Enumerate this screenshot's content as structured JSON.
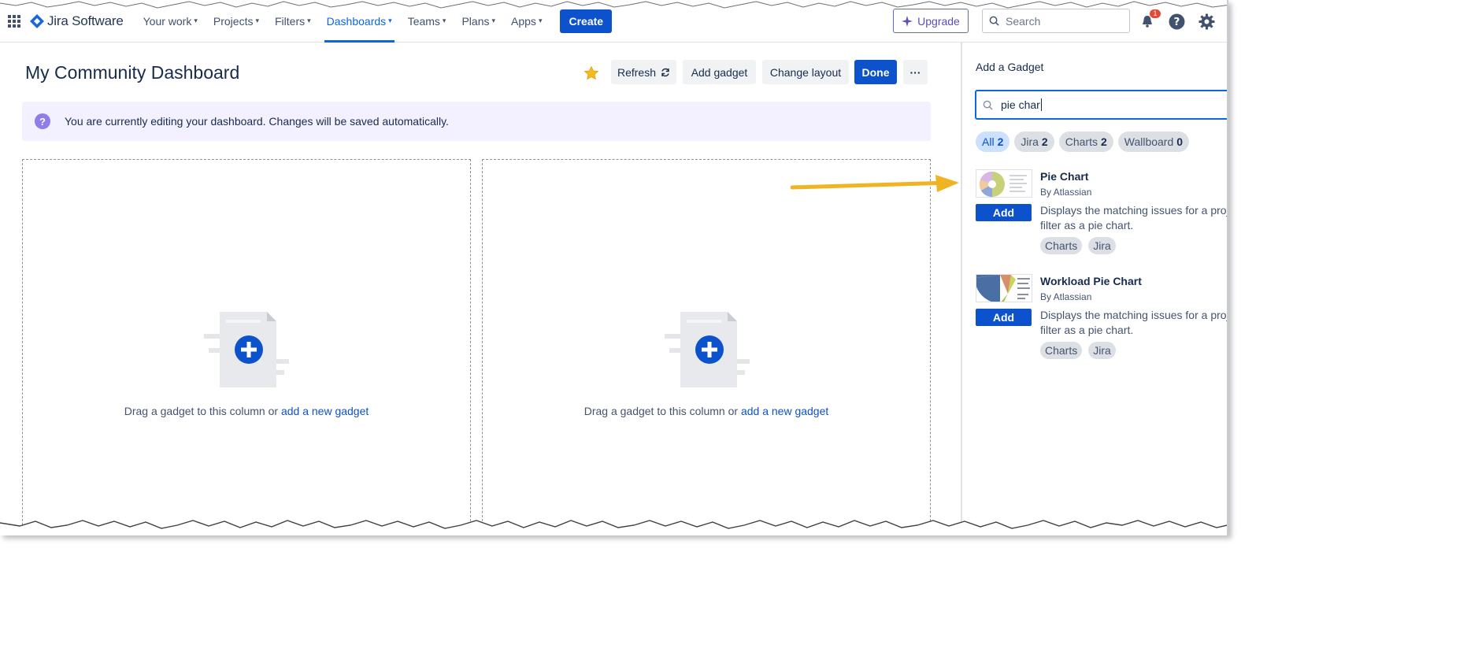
{
  "topnav": {
    "logo_text": "Jira Software",
    "items": [
      {
        "label": "Your work"
      },
      {
        "label": "Projects"
      },
      {
        "label": "Filters"
      },
      {
        "label": "Dashboards"
      },
      {
        "label": "Teams"
      },
      {
        "label": "Plans"
      },
      {
        "label": "Apps"
      }
    ],
    "create_label": "Create",
    "upgrade_label": "Upgrade",
    "search_placeholder": "Search",
    "notification_count": "1"
  },
  "dashboard": {
    "title": "My Community Dashboard",
    "buttons": {
      "refresh": "Refresh",
      "add_gadget": "Add gadget",
      "change_layout": "Change layout",
      "done": "Done",
      "more": "···"
    },
    "banner_text": "You are currently editing your dashboard. Changes will be saved automatically.",
    "columns": [
      {
        "text": "Drag a gadget to this column or",
        "link": "add a new gadget"
      },
      {
        "text": "Drag a gadget to this column or",
        "link": "add a new gadget"
      }
    ]
  },
  "panel": {
    "title": "Add a Gadget",
    "search_value": "pie char",
    "chips": [
      {
        "label": "All",
        "count": "2",
        "selected": true
      },
      {
        "label": "Jira",
        "count": "2"
      },
      {
        "label": "Charts",
        "count": "2"
      },
      {
        "label": "Wallboard",
        "count": "0"
      }
    ],
    "gadgets": [
      {
        "name": "Pie Chart",
        "by": "By Atlassian",
        "add_label": "Add",
        "desc_line1": "Displays the matching issues for a project",
        "desc_line2": "filter as a pie chart.",
        "tags": [
          "Charts",
          "Jira"
        ]
      },
      {
        "name": "Workload Pie Chart",
        "by": "By Atlassian",
        "add_label": "Add",
        "desc_line1": "Displays the matching issues for a project",
        "desc_line2": "filter as a pie chart.",
        "tags": [
          "Charts",
          "Jira"
        ]
      }
    ]
  },
  "colors": {
    "primary": "#0c52cc",
    "nav_active": "#0c66e4",
    "banner_bg": "#f3f0ff",
    "arrow": "#f0b323"
  }
}
